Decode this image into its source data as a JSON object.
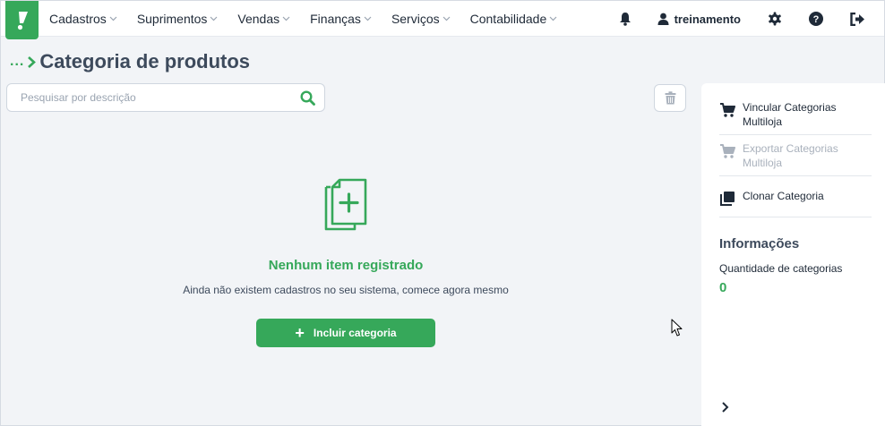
{
  "nav": {
    "menu": [
      {
        "label": "Cadastros"
      },
      {
        "label": "Suprimentos"
      },
      {
        "label": "Vendas"
      },
      {
        "label": "Finanças"
      },
      {
        "label": "Serviços"
      },
      {
        "label": "Contabilidade"
      }
    ],
    "user_name": "treinamento",
    "icons": [
      "bell-icon",
      "user-icon",
      "gear-icon",
      "help-icon",
      "logout-icon"
    ]
  },
  "breadcrumb": {
    "ellipsis": "...",
    "title": "Categoria de produtos"
  },
  "search": {
    "placeholder": "Pesquisar por descrição",
    "value": ""
  },
  "empty_state": {
    "title": "Nenhum item registrado",
    "subtitle": "Ainda não existem cadastros no seu sistema, comece agora mesmo",
    "button_label": "Incluir categoria"
  },
  "side_panel": {
    "actions": [
      {
        "label": "Vincular Categorias Multiloja",
        "icon": "cart-icon",
        "enabled": true
      },
      {
        "label": "Exportar Categorias Multiloja",
        "icon": "cart-icon",
        "enabled": false
      },
      {
        "label": "Clonar Categoria",
        "icon": "copy-icon",
        "enabled": true
      }
    ],
    "info_title": "Informações",
    "info_label": "Quantidade de categorias",
    "info_value": "0"
  },
  "colors": {
    "brand_green": "#36a85a",
    "text_dark": "#1f2a38",
    "text_slate": "#3d4a5c",
    "background": "#f2f4f7"
  }
}
